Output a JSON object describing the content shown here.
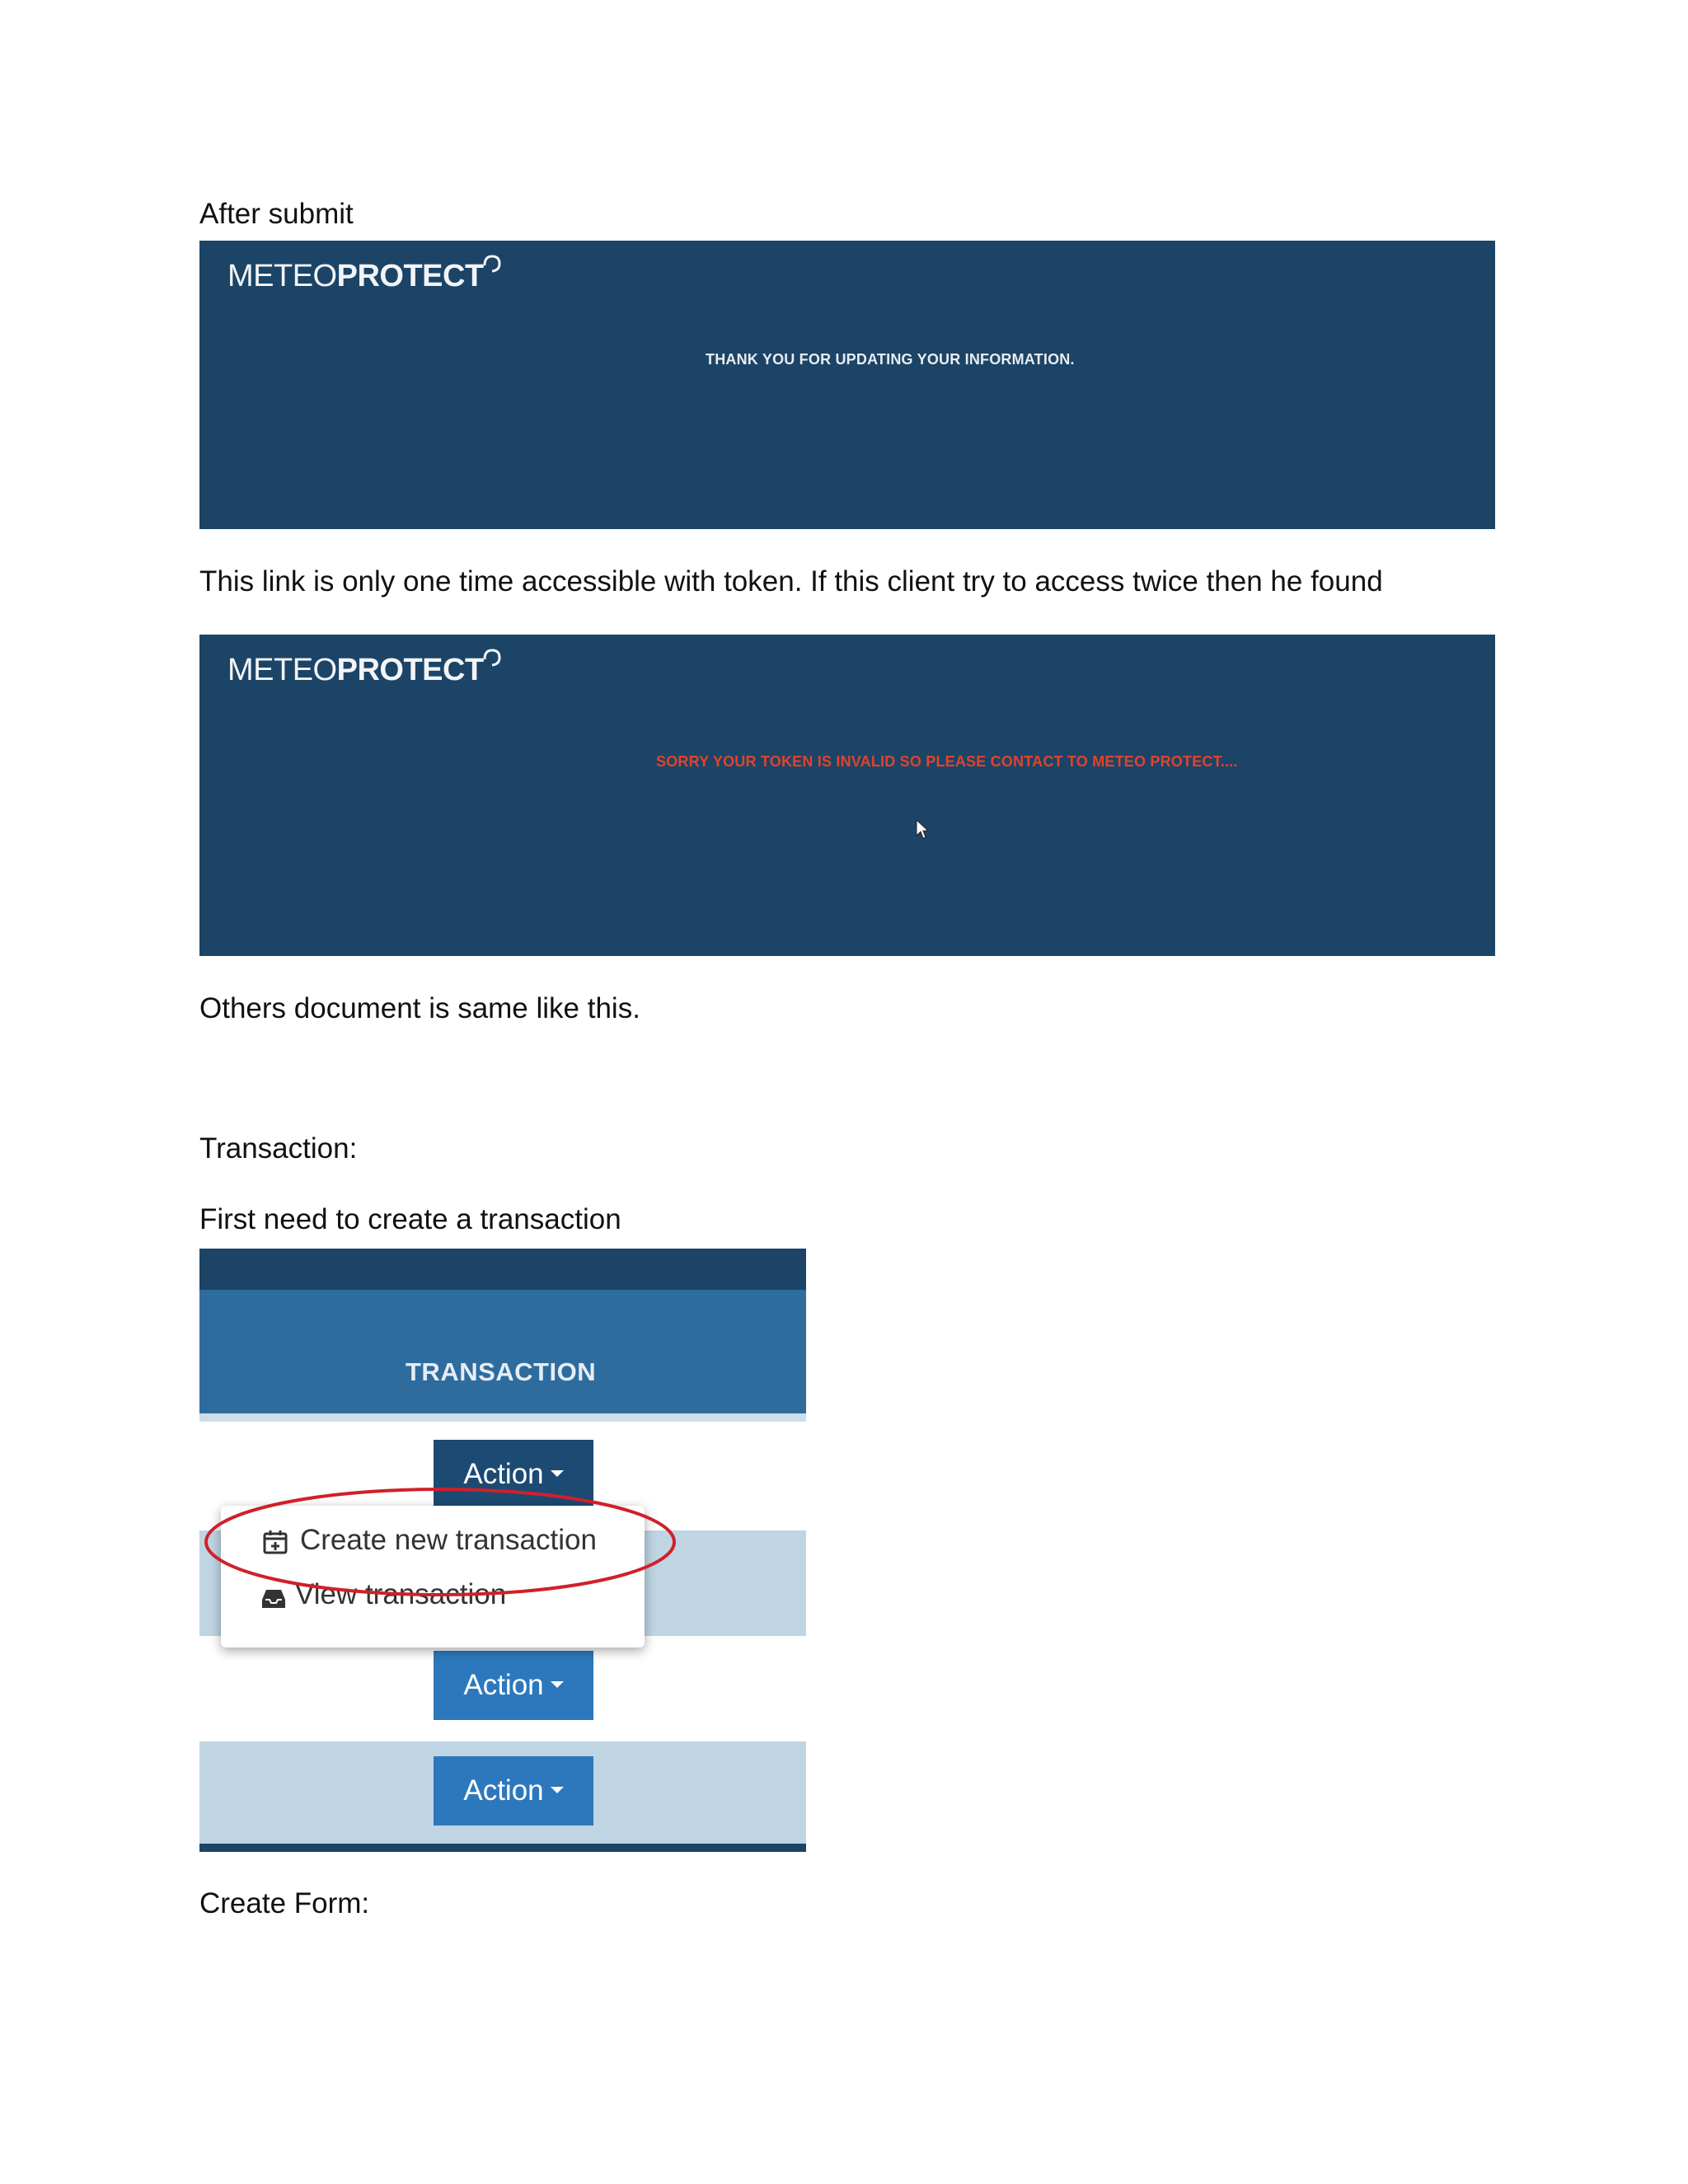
{
  "doc": {
    "p1": "After submit",
    "p2": "This link is only one time accessible with token. If this client try to access twice then he found",
    "p3": "Others document is same like this.",
    "p4": "Transaction:",
    "p5": "First need to create a transaction",
    "p6": "Create Form:"
  },
  "panel1": {
    "logo_thin": "METEO",
    "logo_bold": "PROTECT",
    "message": "THANK YOU FOR UPDATING YOUR INFORMATION."
  },
  "panel2": {
    "logo_thin": "METEO",
    "logo_bold": "PROTECT",
    "message": "SORRY YOUR TOKEN IS INVALID SO PLEASE CONTACT TO METEO PROTECT....",
    "message_color": "#e0432e"
  },
  "transaction": {
    "header_title": "TRANSACTION",
    "action_label": "Action",
    "menu": {
      "create": "Create new transaction",
      "view": "View transaction"
    },
    "icons": [
      "calendar-plus-icon",
      "inbox-icon",
      "caret-down-icon"
    ],
    "colors": {
      "header": "#2e6c9e",
      "top_bar": "#1c4466",
      "button_dark": "#1c4a72",
      "button": "#2d78bd",
      "row_alt": "#bfd5e3",
      "annotation": "#d0202a"
    }
  }
}
